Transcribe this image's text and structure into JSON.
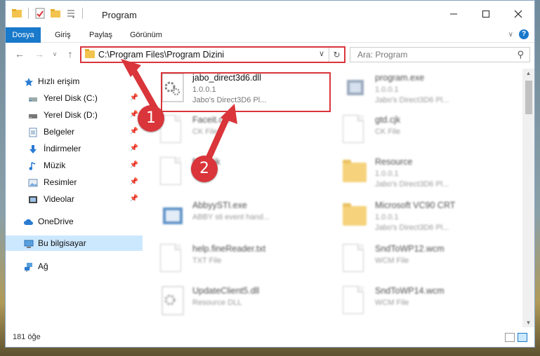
{
  "window": {
    "title": "Program"
  },
  "ribbon": {
    "tabs": [
      "Dosya",
      "Giriş",
      "Paylaş",
      "Görünüm"
    ]
  },
  "address": {
    "path": "C:\\Program Files\\Program Dizini"
  },
  "search": {
    "placeholder": "Ara: Program"
  },
  "sidebar": {
    "items": [
      {
        "label": "Hızlı erişim",
        "icon": "star-icon"
      },
      {
        "label": "Yerel Disk (C:)",
        "icon": "drive-icon"
      },
      {
        "label": "Yerel Disk (D:)",
        "icon": "drive-icon"
      },
      {
        "label": "Belgeler",
        "icon": "documents-icon"
      },
      {
        "label": "İndirmeler",
        "icon": "download-icon"
      },
      {
        "label": "Müzik",
        "icon": "music-icon"
      },
      {
        "label": "Resimler",
        "icon": "pictures-icon"
      },
      {
        "label": "Videolar",
        "icon": "videos-icon"
      },
      {
        "label": "OneDrive",
        "icon": "cloud-icon"
      },
      {
        "label": "Bu bilgisayar",
        "icon": "computer-icon"
      },
      {
        "label": "Ağ",
        "icon": "network-icon"
      }
    ]
  },
  "files": [
    {
      "name": "jabo_direct3d6.dll",
      "line1": "1.0.0.1",
      "line2": "Jabo's Direct3D6 Pl...",
      "icon": "dll-gear-icon"
    },
    {
      "name": "program.exe",
      "line1": "1.0.0.1",
      "line2": "Jabo's Direct3D6 Pl...",
      "icon": "exe-icon"
    },
    {
      "name": "Faceit.cjk",
      "line1": "CK File",
      "line2": "",
      "icon": "file-icon"
    },
    {
      "name": "gtd.cjk",
      "line1": "CK File",
      "line2": "",
      "icon": "file-icon"
    },
    {
      "name": "font.cjk",
      "line1": "",
      "line2": "",
      "icon": "file-icon"
    },
    {
      "name": "Resource",
      "line1": "1.0.0.1",
      "line2": "Jabo's Direct3D6 Pl...",
      "icon": "folder-icon"
    },
    {
      "name": "AbbyySTI.exe",
      "line1": "ABBY sti event hand...",
      "line2": "",
      "icon": "exe-icon"
    },
    {
      "name": "Microsoft VC90 CRT",
      "line1": "1.0.0.1",
      "line2": "Jabo's Direct3D6 Pl...",
      "icon": "folder-icon"
    },
    {
      "name": "help.fineReader.txt",
      "line1": "TXT File",
      "line2": "",
      "icon": "file-icon"
    },
    {
      "name": "SndToWP12.wcm",
      "line1": "WCM File",
      "line2": "",
      "icon": "file-icon"
    },
    {
      "name": "UpdateClient5.dll",
      "line1": "Resource DLL",
      "line2": "",
      "icon": "dll-gear-icon"
    },
    {
      "name": "SndToWP14.wcm",
      "line1": "WCM File",
      "line2": "",
      "icon": "file-icon"
    }
  ],
  "status": {
    "item_count": "181 öğe"
  },
  "annotations": {
    "badge1": "1",
    "badge2": "2"
  },
  "colors": {
    "accent": "#1979ca",
    "highlight": "#d9353a",
    "selection": "#cce8ff"
  }
}
